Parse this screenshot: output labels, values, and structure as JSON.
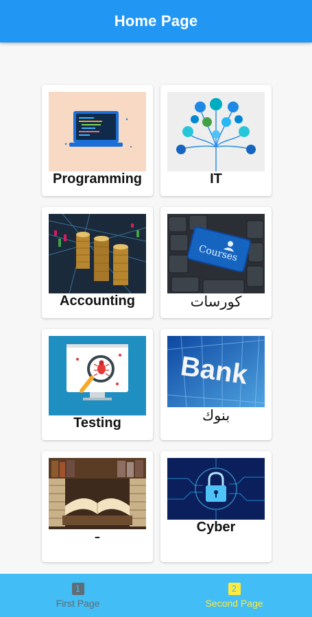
{
  "appbar": {
    "title": "Home Page"
  },
  "cards": [
    {
      "label": "Programming"
    },
    {
      "label": "IT"
    },
    {
      "label": "Accounting"
    },
    {
      "label": "كورسات"
    },
    {
      "label": "Testing"
    },
    {
      "label": "بنوك"
    },
    {
      "label": "ـ"
    },
    {
      "label": "Cyber"
    }
  ],
  "thumbs": {
    "courses_key_text": "Courses",
    "bank_sign_text": "Bank"
  },
  "bottom_nav": {
    "tabs": [
      {
        "icon": "1",
        "label": "First Page",
        "selected": false
      },
      {
        "icon": "2",
        "label": "Second Page",
        "selected": true
      }
    ]
  },
  "colors": {
    "appbar": "#2196f3",
    "bottom_nav": "#42bdf5",
    "selected_tab": "#ffeb3b",
    "unselected_tab": "#5f6d76"
  }
}
